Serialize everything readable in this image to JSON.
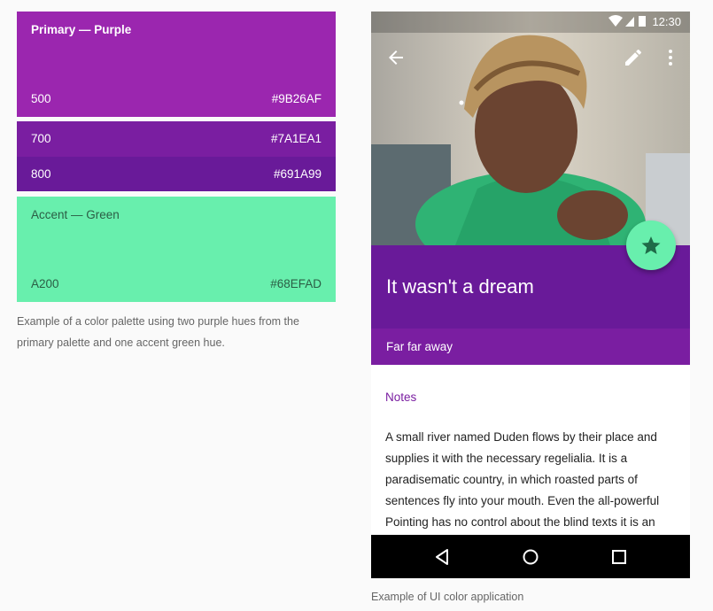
{
  "palette": {
    "primary": {
      "title": "Primary — Purple",
      "name": "500",
      "hex": "#9B26AF"
    },
    "dark700": {
      "name": "700",
      "hex": "#7A1EA1"
    },
    "dark800": {
      "name": "800",
      "hex": "#691A99"
    },
    "accent": {
      "title": "Accent — Green",
      "name": "A200",
      "hex": "#68EFAD"
    },
    "caption": "Example of a color palette using two purple hues from the primary palette and one accent green hue."
  },
  "phone": {
    "status_time": "12:30",
    "title": "It wasn't a dream",
    "subtitle": "Far far away",
    "notes_heading": "Notes",
    "body": "A small river named Duden flows by their place and supplies it with the necessary regelialia. It is a paradisematic country, in which roasted parts of sentences fly into your mouth. Even the all-powerful Pointing has no control about the blind texts it is an",
    "icons": [
      "back-arrow-icon",
      "edit-pencil-icon",
      "more-vert-icon",
      "star-icon",
      "nav-back-icon",
      "nav-home-icon",
      "nav-recents-icon"
    ]
  },
  "caption_right": "Example of UI color application"
}
